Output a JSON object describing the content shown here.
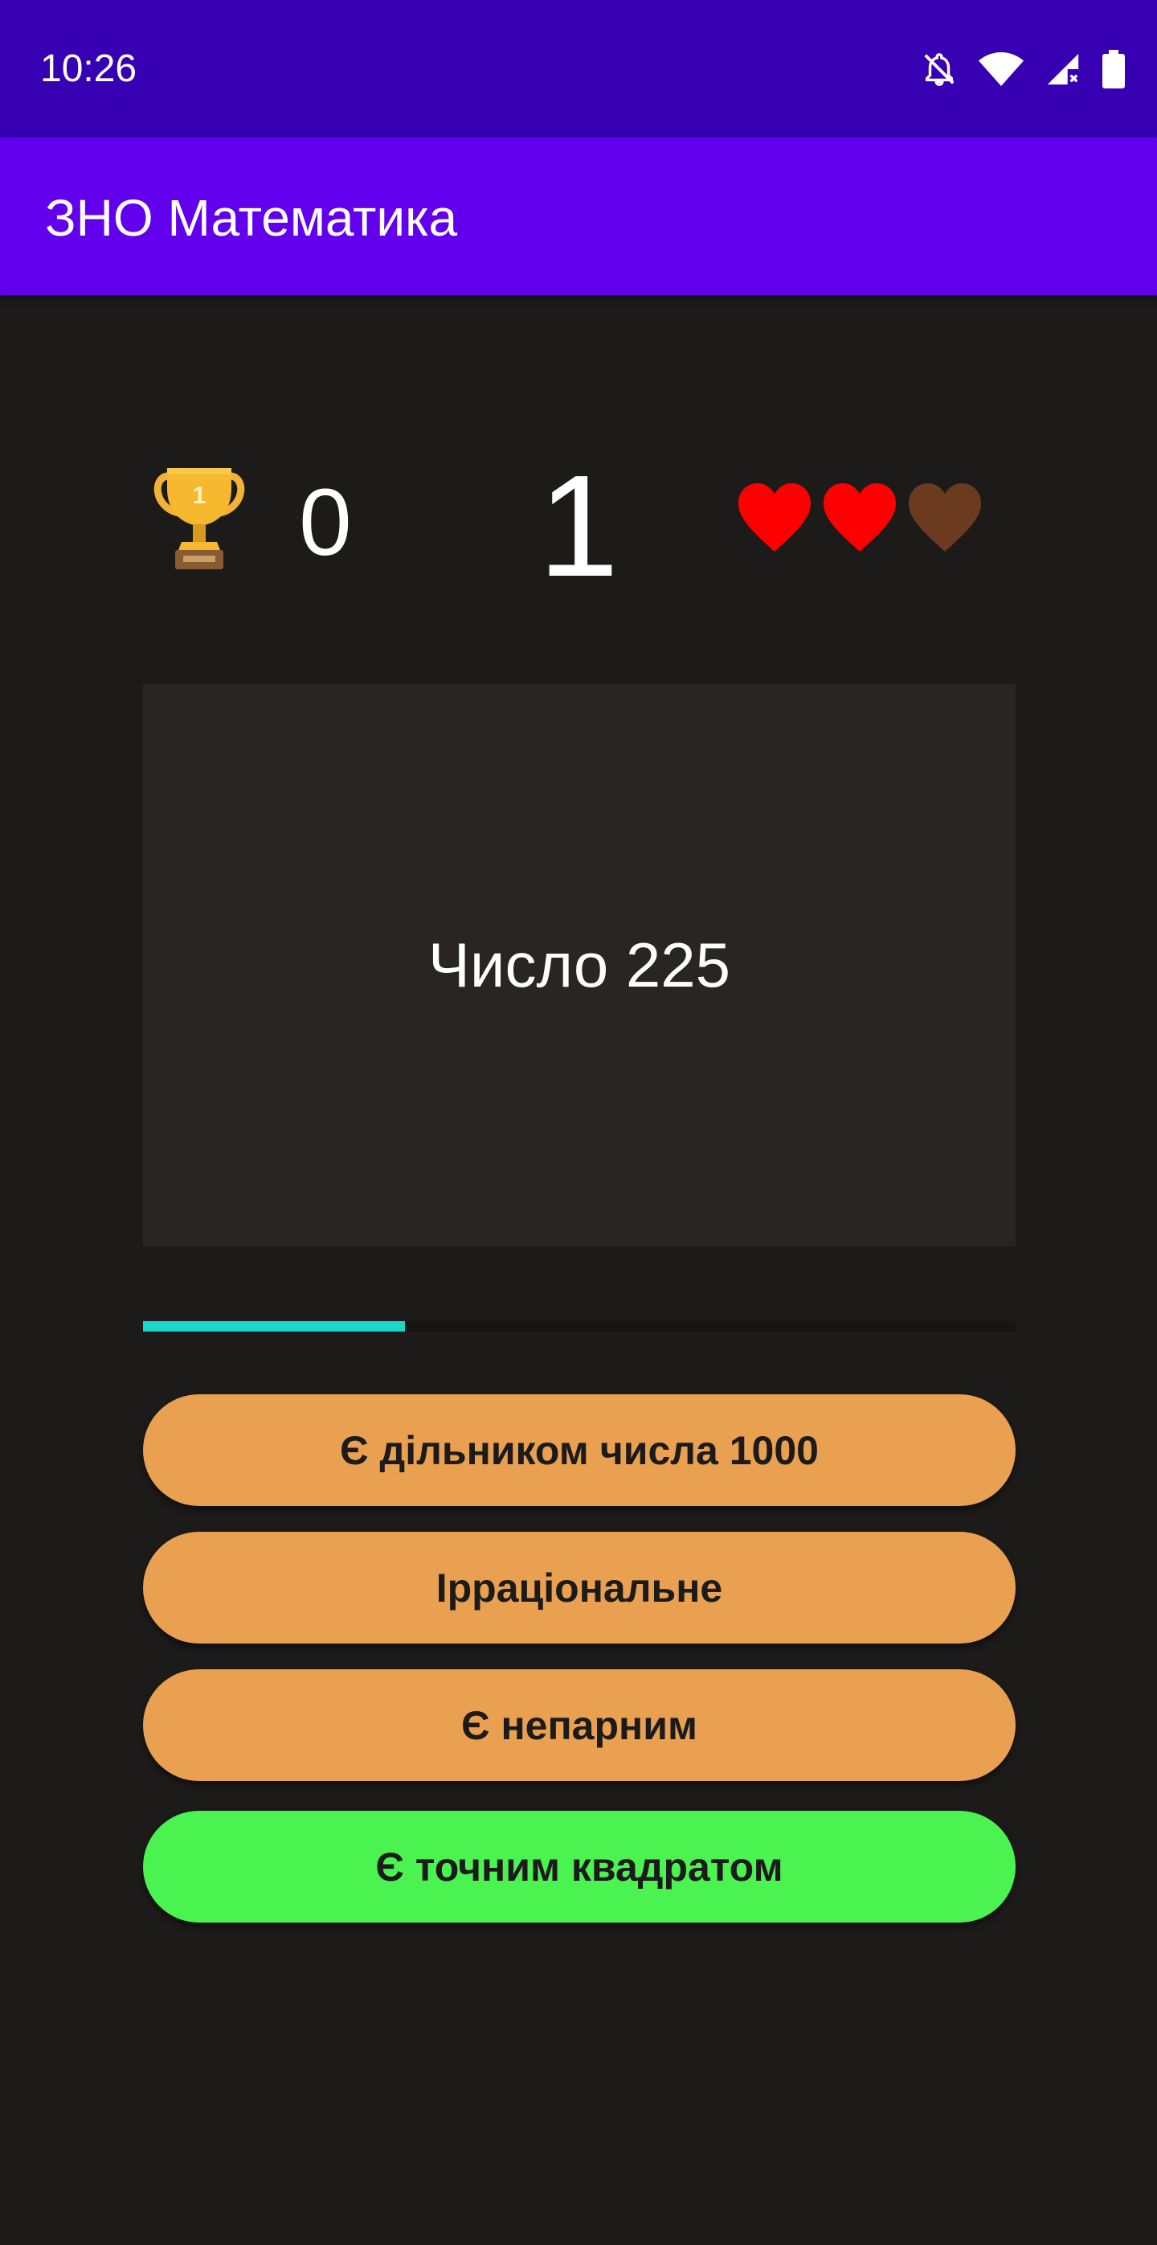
{
  "status_bar": {
    "time": "10:26",
    "icons": [
      "notifications-off-icon",
      "wifi-icon",
      "signal-no-data-icon",
      "battery-icon"
    ]
  },
  "app_bar": {
    "title": "ЗНО Математика"
  },
  "game": {
    "score": "0",
    "question_number": "1",
    "lives_total": 3,
    "lives_remaining": 2,
    "progress_fraction": 0.3
  },
  "question": {
    "text": "Число 225"
  },
  "answers": [
    {
      "label": "Є дільником числа 1000",
      "state": "default"
    },
    {
      "label": "Ірраціональне",
      "state": "default"
    },
    {
      "label": "Є непарним",
      "state": "default"
    },
    {
      "label": "Є точним квадратом",
      "state": "correct"
    }
  ],
  "colors": {
    "status_bar": "#3700b3",
    "app_bar": "#6200ee",
    "background": "#1c1b1a",
    "card": "#282524",
    "progress": "#1ad7c8",
    "answer_default": "#e9a050",
    "answer_correct": "#4bf350",
    "heart_full": "#ff0000",
    "heart_empty": "#6b3a1f"
  }
}
